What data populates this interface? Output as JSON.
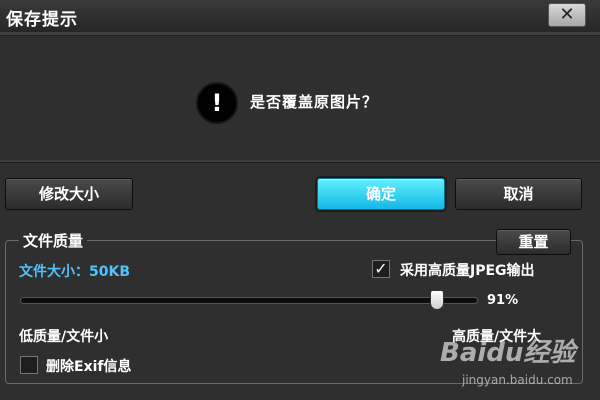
{
  "dialog": {
    "title": "保存提示",
    "close_label": "✕"
  },
  "message": {
    "icon": "exclamation-icon",
    "icon_glyph": "!",
    "text": "是否覆盖原图片？"
  },
  "buttons": {
    "resize_label": "修改大小",
    "ok_label": "确定",
    "cancel_label": "取消"
  },
  "quality": {
    "group_label": "文件质量",
    "reset_label": "重置",
    "file_size_text": "文件大小：50KB",
    "high_quality_jpeg_label": "采用高质量JPEG输出",
    "high_quality_jpeg_checked": true,
    "slider_value": 91,
    "slider_value_text": "91%",
    "low_label": "低质量/文件小",
    "high_label": "高质量/文件大",
    "remove_exif_label": "删除Exif信息",
    "remove_exif_checked": false
  },
  "watermark": {
    "logo_text": "Baidu经验",
    "url_text": "jingyan.baidu.com"
  },
  "colors": {
    "background": "#2f2f2f",
    "accent_ok": "#15b8e6",
    "file_size_text": "#4fc3ff"
  }
}
